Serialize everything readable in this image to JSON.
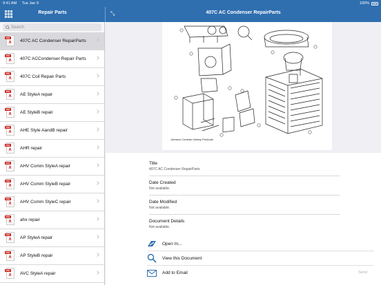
{
  "status": {
    "time": "9:41 AM",
    "date": "Tue Jan 9",
    "battery": "100%"
  },
  "sidebar": {
    "title": "Repair Parts",
    "search_placeholder": "Search",
    "items": [
      {
        "label": "407C AC Condenser RepairParts",
        "selected": true
      },
      {
        "label": "407C ACCondenser Repair Parts"
      },
      {
        "label": "407C Coil Repair Parts"
      },
      {
        "label": "AE StyleA repair"
      },
      {
        "label": "AE StyleB repair"
      },
      {
        "label": "AHE Style AandB repair"
      },
      {
        "label": "AHR repair"
      },
      {
        "label": "AHV Comm StyleA repair"
      },
      {
        "label": "AHV Comm StyleB repair"
      },
      {
        "label": "AHV Comm StyleC repair"
      },
      {
        "label": "ahx repair"
      },
      {
        "label": "AP StyleA repair"
      },
      {
        "label": "AP StyleB repair"
      },
      {
        "label": "AVC StyleA repair"
      }
    ]
  },
  "detail": {
    "title": "407C AC Condenser RepairParts",
    "preview_caption": "Johnson Controls Unitary Products",
    "meta": [
      {
        "key": "Title",
        "value": "407C AC Condenser RepairParts"
      },
      {
        "key": "Date Created",
        "value": "Not available."
      },
      {
        "key": "Date Modified",
        "value": "Not available."
      },
      {
        "key": "Document Details",
        "value": "Not available."
      }
    ],
    "actions": [
      {
        "label": "Open In...",
        "icon": "open-in-icon"
      },
      {
        "label": "View this Document",
        "icon": "magnifier-icon"
      },
      {
        "label": "Add to Email",
        "icon": "envelope-icon"
      }
    ],
    "send_label": "Send"
  },
  "colors": {
    "accent": "#2f6fb0",
    "pdf_red": "#d0201a"
  }
}
